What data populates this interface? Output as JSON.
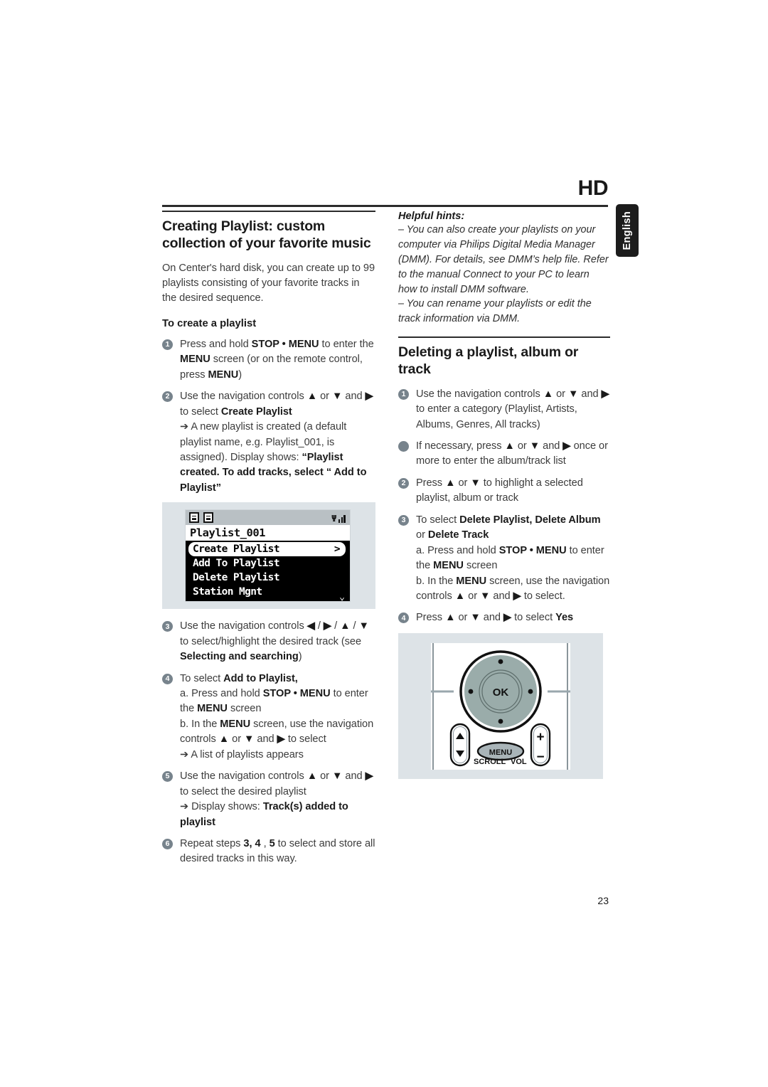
{
  "header": {
    "chapter_label": "HD",
    "language_tab": "English"
  },
  "page_number": "23",
  "left_column": {
    "heading": "Creating Playlist:  custom collection of your favorite music",
    "intro": "On Center's hard disk, you can create up to 99 playlists consisting of your favorite tracks in the desired sequence.",
    "sub_heading": "To create a playlist",
    "steps": [
      {
        "num": "1",
        "lines": [
          "Press and hold <b>STOP • MENU</b> to enter the <b>MENU</b> screen (or on the remote control, press <b>MENU</b>)"
        ]
      },
      {
        "num": "2",
        "lines": [
          "Use the navigation controls <b>▲</b> or <b>▼</b> and <b>▶</b> to select <b>Create Playlist</b>",
          "➔ A new playlist is created (a default playlist name, e.g. Playlist_001, is assigned). Display shows: <b>“Playlist created. To add tracks, select “ Add to Playlist”</b>"
        ]
      },
      {
        "num": "3",
        "lines": [
          "Use the navigation controls <b>◀</b> / <b>▶</b> / <b>▲</b> / <b>▼</b> to select/highlight the desired track (see <b>Selecting and searching</b>)"
        ]
      },
      {
        "num": "4",
        "lines": [
          "To select <b>Add to Playlist,</b>",
          "a. Press and hold <b>STOP • MENU</b> to enter the <b>MENU</b> screen",
          "b. In the <b>MENU</b> screen, use the navigation controls <b>▲</b> or <b>▼</b> and <b>▶</b> to select",
          "➔ A list of playlists appears"
        ]
      },
      {
        "num": "5",
        "lines": [
          "Use the navigation controls <b>▲</b> or <b>▼</b> and <b>▶</b> to select the desired playlist",
          "➔ Display shows: <b>Track(s) added to playlist</b>"
        ]
      },
      {
        "num": "6",
        "lines": [
          "Repeat steps <b>3, 4</b> , <b>5</b> to select and store all desired tracks in this way."
        ]
      }
    ]
  },
  "lcd_figure": {
    "status_icons": [
      "list-icon",
      "list-icon",
      "wifi-signal-icon"
    ],
    "title": "Playlist_001",
    "items": [
      {
        "label": "Create Playlist",
        "selected": true,
        "arrow": ">"
      },
      {
        "label": "Add To Playlist",
        "selected": false
      },
      {
        "label": "Delete Playlist",
        "selected": false
      },
      {
        "label": "Station Mgnt",
        "selected": false
      }
    ],
    "scroll_indicator": "⌄"
  },
  "right_column": {
    "hints_title": "Helpful hints:",
    "hints": [
      "– You can also create your playlists on your computer via Philips Digital Media Manager (DMM). For details, see DMM’s help file. Refer to the manual Connect to your PC to learn how to install DMM software.",
      "– You can rename your playlists or edit the track information via DMM."
    ],
    "heading": "Deleting a playlist, album or track",
    "steps": [
      {
        "num": "1",
        "lines": [
          "Use the navigation controls <b>▲</b> or <b>▼</b> and <b>▶</b> to enter a category (Playlist, Artists, Albums, Genres, All tracks)"
        ]
      },
      {
        "num": "",
        "lines": [
          "If necessary,  press <b>▲</b> or <b>▼</b> and <b>▶</b> once or more to enter the album/track list"
        ]
      },
      {
        "num": "2",
        "lines": [
          "Press <b>▲</b> or <b>▼</b>  to highlight a selected playlist, album or track"
        ]
      },
      {
        "num": "3",
        "lines": [
          "To select <b>Delete Playlist, Delete Album</b> or <b>Delete Track</b>",
          "a. Press and hold <b>STOP • MENU</b> to enter the <b>MENU</b> screen",
          "b. In the <b>MENU</b> screen, use the navigation controls <b>▲</b> or <b>▼</b> and <b>▶</b> to select."
        ]
      },
      {
        "num": "4",
        "lines": [
          "Press <b>▲</b> or <b>▼</b> and <b>▶</b> to select <b>Yes</b>"
        ]
      }
    ]
  },
  "remote_figure": {
    "ok_label": "OK",
    "menu_label": "MENU",
    "scroll_label": "SCROLL",
    "vol_label": "VOL",
    "vol_plus": "+",
    "vol_minus": "−",
    "scroll_up": "▲",
    "scroll_down": "▼",
    "wheel_color": "#9aacaa"
  }
}
